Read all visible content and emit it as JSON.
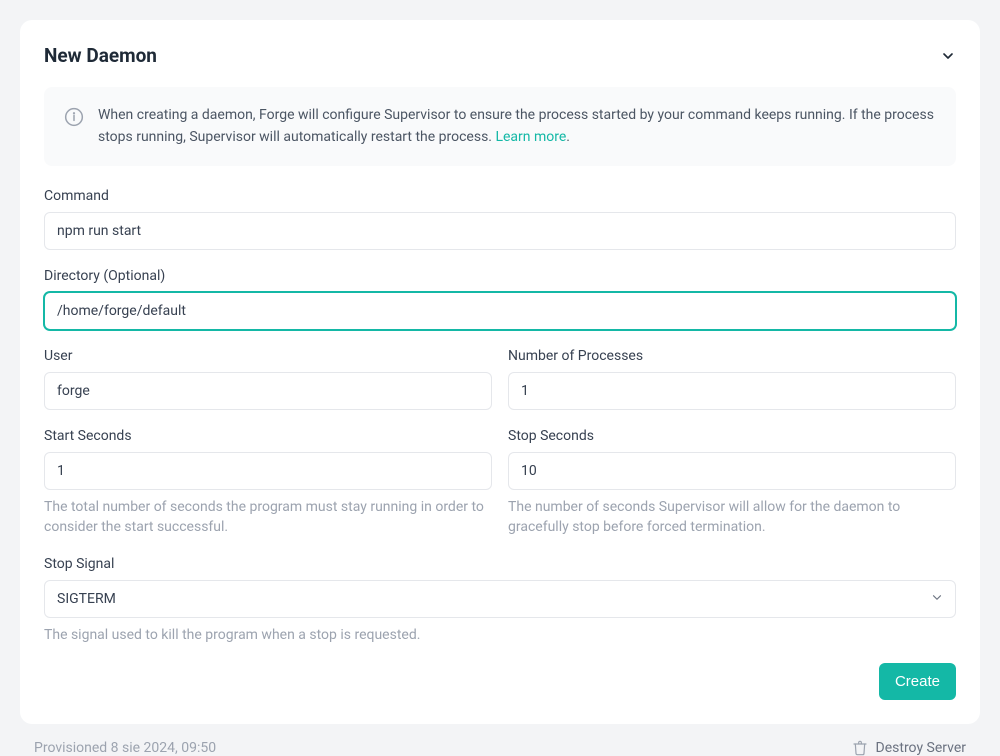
{
  "header": {
    "title": "New Daemon"
  },
  "infoBanner": {
    "text": "When creating a daemon, Forge will configure Supervisor to ensure the process started by your command keeps running. If the process stops running, Supervisor will automatically restart the process. ",
    "linkText": "Learn more"
  },
  "form": {
    "command": {
      "label": "Command",
      "value": "npm run start"
    },
    "directory": {
      "label": "Directory (Optional)",
      "value": "/home/forge/default"
    },
    "user": {
      "label": "User",
      "value": "forge"
    },
    "processes": {
      "label": "Number of Processes",
      "value": "1"
    },
    "startSeconds": {
      "label": "Start Seconds",
      "value": "1",
      "helper": "The total number of seconds the program must stay running in order to consider the start successful."
    },
    "stopSeconds": {
      "label": "Stop Seconds",
      "value": "10",
      "helper": "The number of seconds Supervisor will allow for the daemon to gracefully stop before forced termination."
    },
    "stopSignal": {
      "label": "Stop Signal",
      "value": "SIGTERM",
      "helper": "The signal used to kill the program when a stop is requested."
    }
  },
  "actions": {
    "create": "Create"
  },
  "footer": {
    "provisioned": "Provisioned 8 sie 2024, 09:50",
    "destroy": "Destroy Server"
  }
}
